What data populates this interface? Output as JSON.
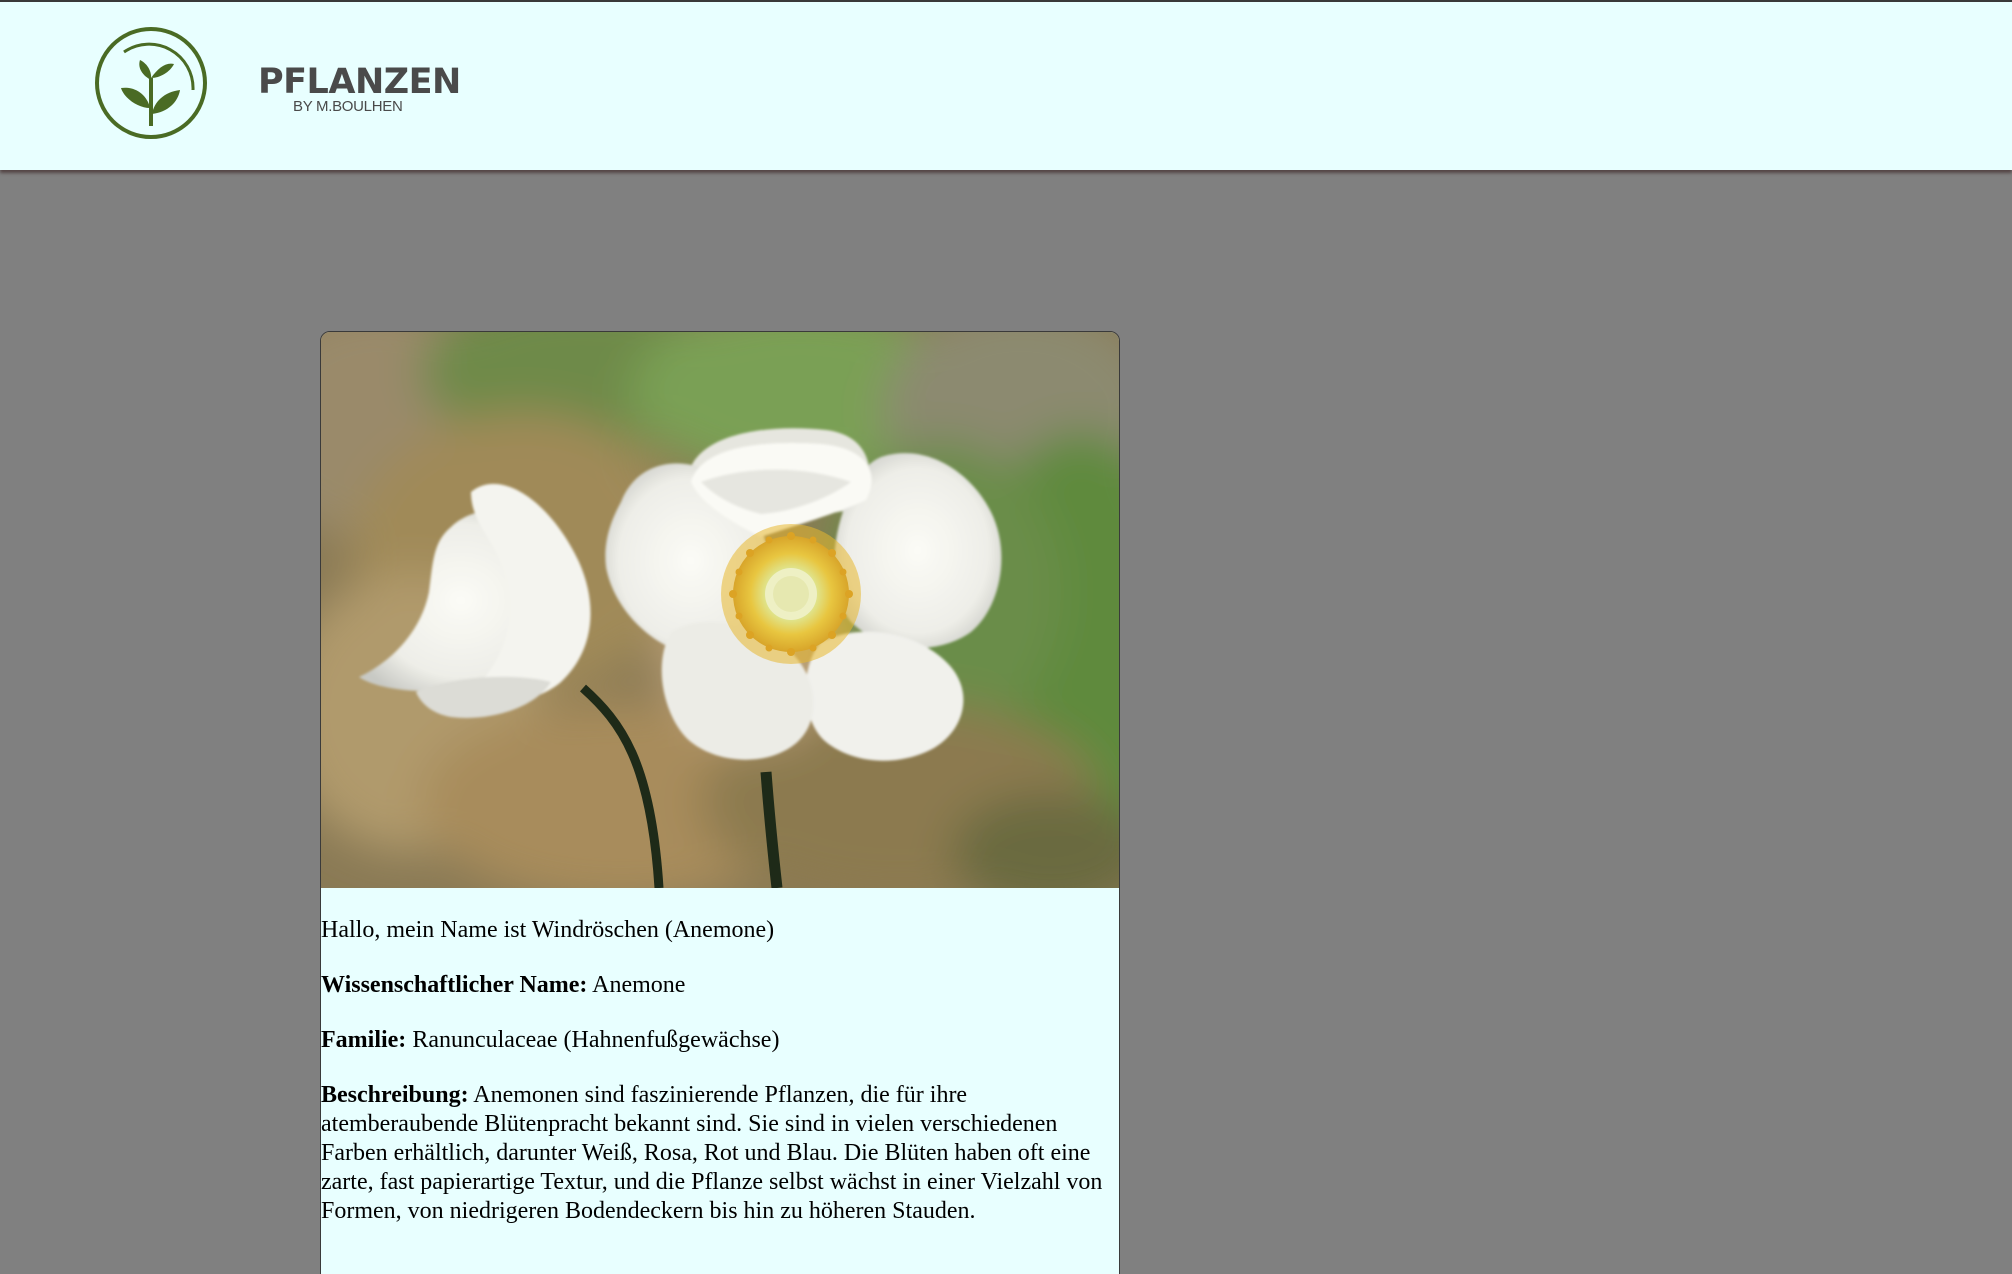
{
  "header": {
    "brand_name": "PFLANZEN",
    "brand_sub": "BY M.BOULHEN",
    "logo_icon": "sprout-in-circle-icon"
  },
  "colors": {
    "page_background": "#808080",
    "header_background": "#e8ffff",
    "card_background": "#e8ffff",
    "brand_text": "#4a4a4a",
    "logo_green": "#4a6b24"
  },
  "card": {
    "image": {
      "icon": "anemone-flower-photo"
    },
    "greeting": "Hallo, mein Name ist Windröschen (Anemone)",
    "scientific_name_label": "Wissenschaftlicher Name:",
    "scientific_name_value": "Anemone",
    "family_label": "Familie:",
    "family_value": "Ranunculaceae (Hahnenfußgewächse)",
    "description_label": "Beschreibung:",
    "description_value": "Anemonen sind faszinierende Pflanzen, die für ihre atemberaubende Blütenpracht bekannt sind. Sie sind in vielen verschiedenen Farben erhältlich, darunter Weiß, Rosa, Rot und Blau. Die Blüten haben oft eine zarte, fast papierartige Textur, und die Pflanze selbst wächst in einer Vielzahl von Formen, von niedrigeren Bodendeckern bis hin zu höheren Stauden."
  }
}
